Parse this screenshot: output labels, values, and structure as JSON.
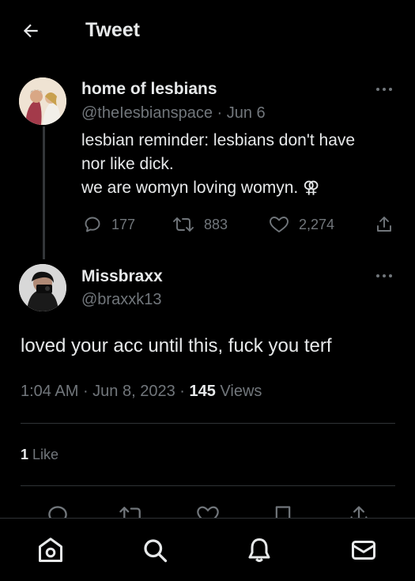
{
  "header": {
    "title": "Tweet"
  },
  "original_tweet": {
    "name": "home of lesbians",
    "handle": "@theIesbianspace",
    "date": "Jun 6",
    "text_lines": [
      "lesbian reminder: lesbians don't have",
      "nor like dick.",
      "we are womyn loving womyn. ⚢"
    ],
    "replies": "177",
    "retweets": "883",
    "likes": "2,274"
  },
  "reply_tweet": {
    "name": "Missbraxx",
    "handle": "@braxxk13",
    "text": "loved your acc until this, fuck you terf",
    "time": "1:04 AM",
    "date": "Jun 8, 2023",
    "views_count": "145",
    "views_label": "Views",
    "likes_count": "1",
    "likes_label": "Like"
  },
  "colors": {
    "background": "#000000",
    "text": "#e7e9ea",
    "secondary": "#71767b",
    "divider": "#2f3336"
  },
  "nav": [
    "home-icon",
    "search-icon",
    "notifications-icon",
    "messages-icon"
  ]
}
